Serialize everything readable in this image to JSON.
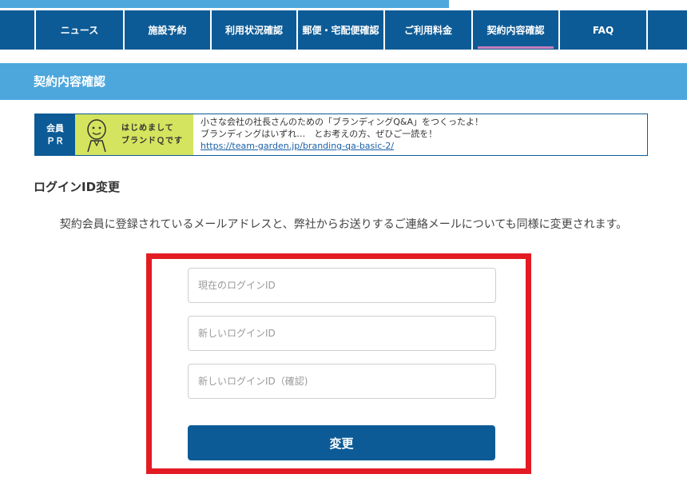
{
  "nav": {
    "items": [
      {
        "label": "ニュース"
      },
      {
        "label": "施設予約"
      },
      {
        "label": "利用状況確認"
      },
      {
        "label": "郵便・宅配便確認"
      },
      {
        "label": "ご利用料金"
      },
      {
        "label": "契約内容確認"
      },
      {
        "label": "FAQ"
      }
    ],
    "active_index": 5
  },
  "page_title": "契約内容確認",
  "ad": {
    "tag_line1": "会員",
    "tag_line2": "ＰＲ",
    "banner_line1": "はじめまして",
    "banner_line2": "ブランドＱです",
    "text_line1": "小さな会社の社長さんのための「ブランディングQ&A」をつくったよ！",
    "text_line2": "ブランディングはいずれ…　とお考えの方、ぜひご一読を！",
    "link": "https://team-garden.jp/branding-qa-basic-2/"
  },
  "section_title": "ログインID変更",
  "description": "契約会員に登録されているメールアドレスと、弊社からお送りするご連絡メールについても同様に変更されます。",
  "form": {
    "current_id_placeholder": "現在のログインID",
    "new_id_placeholder": "新しいログインID",
    "confirm_id_placeholder": "新しいログインID（確認)",
    "submit_label": "変更"
  },
  "colors": {
    "nav_bg": "#0d5b96",
    "title_bar_bg": "#4da7dd",
    "highlight_border": "#e31b23",
    "banner_bg": "#d4e45e"
  }
}
